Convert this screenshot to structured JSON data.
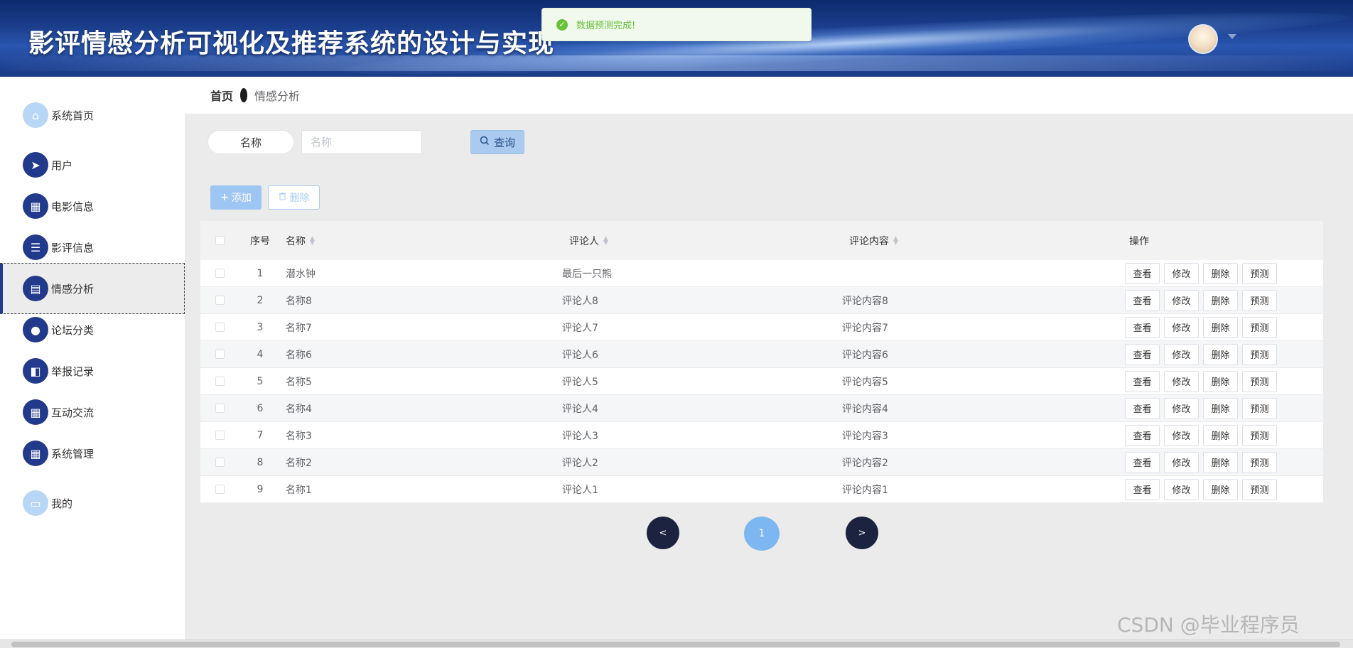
{
  "app": {
    "title": "影评情感分析可视化及推荐系统的设计与实现"
  },
  "toast": {
    "message": "数据预测完成!"
  },
  "breadcrumb": {
    "home": "首页",
    "current": "情感分析"
  },
  "sidebar": {
    "items": [
      {
        "label": "系统首页",
        "icon": "home-icon"
      },
      {
        "label": "用户",
        "icon": "paper-plane-icon"
      },
      {
        "label": "电影信息",
        "icon": "grid-icon"
      },
      {
        "label": "影评信息",
        "icon": "list-icon"
      },
      {
        "label": "情感分析",
        "icon": "clipboard-icon",
        "active": true
      },
      {
        "label": "论坛分类",
        "icon": "user-icon"
      },
      {
        "label": "举报记录",
        "icon": "wallet-icon"
      },
      {
        "label": "互动交流",
        "icon": "grid-icon"
      },
      {
        "label": "系统管理",
        "icon": "grid-icon"
      },
      {
        "label": "我的",
        "icon": "card-icon"
      }
    ]
  },
  "search": {
    "label": "名称",
    "placeholder": "名称",
    "button": "查询"
  },
  "actions": {
    "add": "添加",
    "delete": "删除"
  },
  "table": {
    "headers": {
      "index": "序号",
      "name": "名称",
      "reviewer": "评论人",
      "content": "评论内容",
      "ops": "操作"
    },
    "op_labels": [
      "查看",
      "修改",
      "删除",
      "预测"
    ],
    "rows": [
      {
        "index": "1",
        "name": "潜水钟",
        "reviewer": "最后一只熊",
        "content": ""
      },
      {
        "index": "2",
        "name": "名称8",
        "reviewer": "评论人8",
        "content": "评论内容8"
      },
      {
        "index": "3",
        "name": "名称7",
        "reviewer": "评论人7",
        "content": "评论内容7"
      },
      {
        "index": "4",
        "name": "名称6",
        "reviewer": "评论人6",
        "content": "评论内容6"
      },
      {
        "index": "5",
        "name": "名称5",
        "reviewer": "评论人5",
        "content": "评论内容5"
      },
      {
        "index": "6",
        "name": "名称4",
        "reviewer": "评论人4",
        "content": "评论内容4"
      },
      {
        "index": "7",
        "name": "名称3",
        "reviewer": "评论人3",
        "content": "评论内容3"
      },
      {
        "index": "8",
        "name": "名称2",
        "reviewer": "评论人2",
        "content": "评论内容2"
      },
      {
        "index": "9",
        "name": "名称1",
        "reviewer": "评论人1",
        "content": "评论内容1"
      }
    ]
  },
  "pagination": {
    "prev": "<",
    "current": "1",
    "next": ">"
  },
  "watermark": "CSDN @毕业程序员",
  "colors": {
    "primary": "#223a8c",
    "success": "#67c23a",
    "accent": "#7db7f2"
  }
}
